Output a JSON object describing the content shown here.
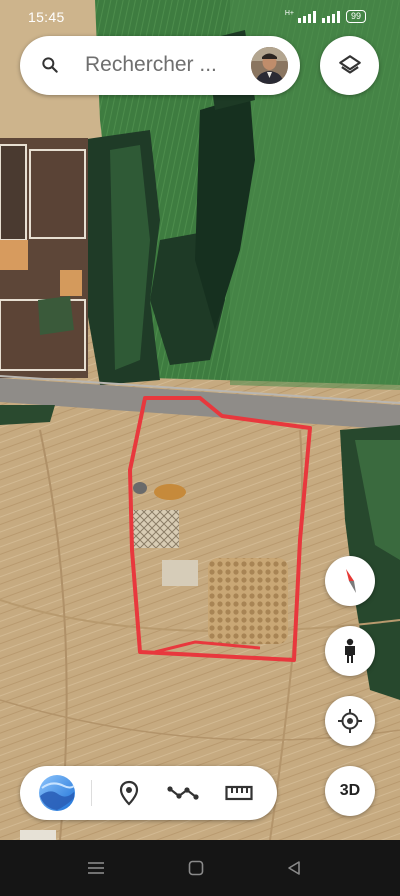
{
  "status_bar": {
    "time": "15:45",
    "network": "H+",
    "battery": "99"
  },
  "search": {
    "placeholder": "Rechercher ..."
  },
  "buttons": {
    "layers": "layers-icon",
    "compass": "compass-icon",
    "street_view": "pegman-icon",
    "my_location": "my-location-icon",
    "three_d": "3D"
  },
  "toolbar": {
    "items": [
      "google-earth-logo",
      "place-pin-icon",
      "path-icon",
      "ruler-icon"
    ]
  },
  "nav_bar": {
    "items": [
      "menu-icon",
      "home-icon",
      "back-icon"
    ]
  },
  "colors": {
    "annotation_outline": "#e8383d",
    "field_green": "#3d7a3d",
    "dry_land": "#c9ad84",
    "road": "#8f8c88"
  }
}
